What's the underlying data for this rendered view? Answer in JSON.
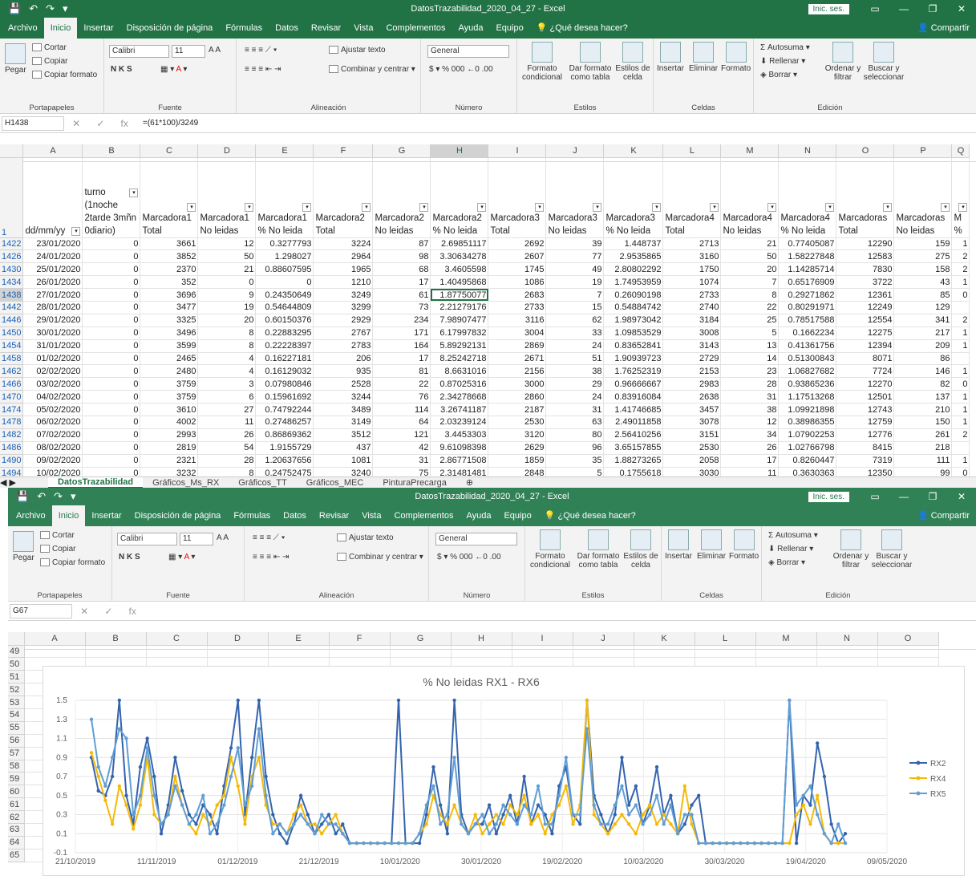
{
  "window1": {
    "title": "DatosTrazabilidad_2020_04_27  -  Excel",
    "signin": "Inic. ses.",
    "tabs": [
      "Archivo",
      "Inicio",
      "Insertar",
      "Disposición de página",
      "Fórmulas",
      "Datos",
      "Revisar",
      "Vista",
      "Complementos",
      "Ayuda",
      "Equipo",
      "¿Qué desea hacer?"
    ],
    "share": "Compartir",
    "ribbon": {
      "pegar": "Pegar",
      "cortar": "Cortar",
      "copiar": "Copiar",
      "copiar_formato": "Copiar formato",
      "portapapeles": "Portapapeles",
      "font": "Calibri",
      "size": "11",
      "fuente": "Fuente",
      "ajustar": "Ajustar texto",
      "combinar": "Combinar y centrar",
      "alineacion": "Alineación",
      "general": "General",
      "numero": "Número",
      "formato_cond": "Formato condicional",
      "formato_tabla": "Dar formato como tabla",
      "estilos_celda": "Estilos de celda",
      "estilos": "Estilos",
      "insertar": "Insertar",
      "eliminar": "Eliminar",
      "formato": "Formato",
      "celdas": "Celdas",
      "autosuma": "Autosuma",
      "rellenar": "Rellenar",
      "borrar": "Borrar",
      "ordenar": "Ordenar y filtrar",
      "buscar": "Buscar y seleccionar",
      "edicion": "Edición"
    },
    "namebox": "H1438",
    "formula": "=(61*100)/3249",
    "columns": [
      "A",
      "B",
      "C",
      "D",
      "E",
      "F",
      "G",
      "H",
      "I",
      "J",
      "K",
      "L",
      "M",
      "N",
      "O",
      "P",
      "Q"
    ],
    "header_row": "1",
    "headers": [
      "dd/mm/yy",
      "turno (1noche 2tarde 3mñn 0diario)",
      "Marcadora1 Total",
      "Marcadora1 No leidas",
      "Marcadora1 % No leida",
      "Marcadora2 Total",
      "Marcadora2 No leidas",
      "Marcadora2 % No leida",
      "Marcadora3 Total",
      "Marcadora3 No leidas",
      "Marcadora3 % No leida",
      "Marcadora4 Total",
      "Marcadora4 No leidas",
      "Marcadora4 % No leida",
      "Marcadoras Total",
      "Marcadoras No leidas",
      "M %"
    ],
    "rows": [
      {
        "r": "1422",
        "c": [
          "23/01/2020",
          "0",
          "3661",
          "12",
          "0.3277793",
          "3224",
          "87",
          "2.69851117",
          "2692",
          "39",
          "1.448737",
          "2713",
          "21",
          "0.77405087",
          "12290",
          "159",
          "1"
        ]
      },
      {
        "r": "1426",
        "c": [
          "24/01/2020",
          "0",
          "3852",
          "50",
          "1.298027",
          "2964",
          "98",
          "3.30634278",
          "2607",
          "77",
          "2.9535865",
          "3160",
          "50",
          "1.58227848",
          "12583",
          "275",
          "2"
        ]
      },
      {
        "r": "1430",
        "c": [
          "25/01/2020",
          "0",
          "2370",
          "21",
          "0.88607595",
          "1965",
          "68",
          "3.4605598",
          "1745",
          "49",
          "2.80802292",
          "1750",
          "20",
          "1.14285714",
          "7830",
          "158",
          "2"
        ]
      },
      {
        "r": "1434",
        "c": [
          "26/01/2020",
          "0",
          "352",
          "0",
          "0",
          "1210",
          "17",
          "1.40495868",
          "1086",
          "19",
          "1.74953959",
          "1074",
          "7",
          "0.65176909",
          "3722",
          "43",
          "1"
        ]
      },
      {
        "r": "1438",
        "c": [
          "27/01/2020",
          "0",
          "3696",
          "9",
          "0.24350649",
          "3249",
          "61",
          "1.87750077",
          "2683",
          "7",
          "0.26090198",
          "2733",
          "8",
          "0.29271862",
          "12361",
          "85",
          "0"
        ]
      },
      {
        "r": "1442",
        "c": [
          "28/01/2020",
          "0",
          "3477",
          "19",
          "0.54644809",
          "3299",
          "73",
          "2.21279176",
          "2733",
          "15",
          "0.54884742",
          "2740",
          "22",
          "0.80291971",
          "12249",
          "129",
          ""
        ]
      },
      {
        "r": "1446",
        "c": [
          "29/01/2020",
          "0",
          "3325",
          "20",
          "0.60150376",
          "2929",
          "234",
          "7.98907477",
          "3116",
          "62",
          "1.98973042",
          "3184",
          "25",
          "0.78517588",
          "12554",
          "341",
          "2"
        ]
      },
      {
        "r": "1450",
        "c": [
          "30/01/2020",
          "0",
          "3496",
          "8",
          "0.22883295",
          "2767",
          "171",
          "6.17997832",
          "3004",
          "33",
          "1.09853529",
          "3008",
          "5",
          "0.1662234",
          "12275",
          "217",
          "1"
        ]
      },
      {
        "r": "1454",
        "c": [
          "31/01/2020",
          "0",
          "3599",
          "8",
          "0.22228397",
          "2783",
          "164",
          "5.89292131",
          "2869",
          "24",
          "0.83652841",
          "3143",
          "13",
          "0.41361756",
          "12394",
          "209",
          "1"
        ]
      },
      {
        "r": "1458",
        "c": [
          "01/02/2020",
          "0",
          "2465",
          "4",
          "0.16227181",
          "206",
          "17",
          "8.25242718",
          "2671",
          "51",
          "1.90939723",
          "2729",
          "14",
          "0.51300843",
          "8071",
          "86",
          ""
        ]
      },
      {
        "r": "1462",
        "c": [
          "02/02/2020",
          "0",
          "2480",
          "4",
          "0.16129032",
          "935",
          "81",
          "8.6631016",
          "2156",
          "38",
          "1.76252319",
          "2153",
          "23",
          "1.06827682",
          "7724",
          "146",
          "1"
        ]
      },
      {
        "r": "1466",
        "c": [
          "03/02/2020",
          "0",
          "3759",
          "3",
          "0.07980846",
          "2528",
          "22",
          "0.87025316",
          "3000",
          "29",
          "0.96666667",
          "2983",
          "28",
          "0.93865236",
          "12270",
          "82",
          "0"
        ]
      },
      {
        "r": "1470",
        "c": [
          "04/02/2020",
          "0",
          "3759",
          "6",
          "0.15961692",
          "3244",
          "76",
          "2.34278668",
          "2860",
          "24",
          "0.83916084",
          "2638",
          "31",
          "1.17513268",
          "12501",
          "137",
          "1"
        ]
      },
      {
        "r": "1474",
        "c": [
          "05/02/2020",
          "0",
          "3610",
          "27",
          "0.74792244",
          "3489",
          "114",
          "3.26741187",
          "2187",
          "31",
          "1.41746685",
          "3457",
          "38",
          "1.09921898",
          "12743",
          "210",
          "1"
        ]
      },
      {
        "r": "1478",
        "c": [
          "06/02/2020",
          "0",
          "4002",
          "11",
          "0.27486257",
          "3149",
          "64",
          "2.03239124",
          "2530",
          "63",
          "2.49011858",
          "3078",
          "12",
          "0.38986355",
          "12759",
          "150",
          "1"
        ]
      },
      {
        "r": "1482",
        "c": [
          "07/02/2020",
          "0",
          "2993",
          "26",
          "0.86869362",
          "3512",
          "121",
          "3.4453303",
          "3120",
          "80",
          "2.56410256",
          "3151",
          "34",
          "1.07902253",
          "12776",
          "261",
          "2"
        ]
      },
      {
        "r": "1486",
        "c": [
          "08/02/2020",
          "0",
          "2819",
          "54",
          "1.9155729",
          "437",
          "42",
          "9.61098398",
          "2629",
          "96",
          "3.65157855",
          "2530",
          "26",
          "1.02766798",
          "8415",
          "218",
          ""
        ]
      },
      {
        "r": "1490",
        "c": [
          "09/02/2020",
          "0",
          "2321",
          "28",
          "1.20637656",
          "1081",
          "31",
          "2.86771508",
          "1859",
          "35",
          "1.88273265",
          "2058",
          "17",
          "0.8260447",
          "7319",
          "111",
          "1"
        ]
      },
      {
        "r": "1494",
        "c": [
          "10/02/2020",
          "0",
          "3232",
          "8",
          "0.24752475",
          "3240",
          "75",
          "2.31481481",
          "2848",
          "5",
          "0.1755618",
          "3030",
          "11",
          "0.3630363",
          "12350",
          "99",
          "0"
        ]
      }
    ],
    "sheet_tabs": [
      "DatosTrazabilidad",
      "Gráficos_Ms_RX",
      "Gráficos_TT",
      "Gráficos_MEC",
      "PinturaPrecarga"
    ]
  },
  "window2": {
    "title": "DatosTrazabilidad_2020_04_27  -  Excel",
    "signin": "Inic. ses.",
    "tabs": [
      "Archivo",
      "Inicio",
      "Insertar",
      "Disposición de página",
      "Fórmulas",
      "Datos",
      "Revisar",
      "Vista",
      "Complementos",
      "Ayuda",
      "Equipo",
      "¿Qué desea hacer?"
    ],
    "share": "Compartir",
    "namebox": "G67",
    "columns": [
      "A",
      "B",
      "C",
      "D",
      "E",
      "F",
      "G",
      "H",
      "I",
      "J",
      "K",
      "L",
      "M",
      "N",
      "O"
    ],
    "rows": [
      "49",
      "50",
      "51",
      "52",
      "53",
      "54",
      "55",
      "56",
      "57",
      "58",
      "59",
      "60",
      "61",
      "62",
      "63",
      "64",
      "65"
    ]
  },
  "chart_data": {
    "type": "line",
    "title": "% No leidas RX1 - RX6",
    "xlabel": "",
    "ylabel": "",
    "ylim": [
      0,
      1.5
    ],
    "yticks": [
      "1.5",
      "1.3",
      "1.1",
      "0.9",
      "0.7",
      "0.5",
      "0.3",
      "0.1",
      "-0.1"
    ],
    "xticks": [
      "21/10/2019",
      "11/11/2019",
      "01/12/2019",
      "21/12/2019",
      "10/01/2020",
      "30/01/2020",
      "19/02/2020",
      "10/03/2020",
      "30/03/2020",
      "19/04/2020",
      "09/05/2020"
    ],
    "legend_position": "right",
    "series": [
      {
        "name": "RX2",
        "color": "#2e5fab",
        "values": [
          0.9,
          0.55,
          0.5,
          0.7,
          1.5,
          0.5,
          0.2,
          0.8,
          1.1,
          0.7,
          0.1,
          0.4,
          0.9,
          0.55,
          0.3,
          0.2,
          0.4,
          0.3,
          0.1,
          0.6,
          1.0,
          1.5,
          0.3,
          0.9,
          1.5,
          0.7,
          0.3,
          0.1,
          0.0,
          0.2,
          0.5,
          0.3,
          0.1,
          0.2,
          0.3,
          0.1,
          0.2,
          0.0,
          0.0,
          0.0,
          0.0,
          0.0,
          0.0,
          0.0,
          1.5,
          0.0,
          0.0,
          0.0,
          0.3,
          0.8,
          0.4,
          0.1,
          1.5,
          0.3,
          0.1,
          0.2,
          0.2,
          0.4,
          0.1,
          0.3,
          0.5,
          0.2,
          0.7,
          0.2,
          0.4,
          0.3,
          0.1,
          0.6,
          0.8,
          0.3,
          0.2,
          1.5,
          0.5,
          0.3,
          0.1,
          0.3,
          0.9,
          0.4,
          0.6,
          0.2,
          0.4,
          0.8,
          0.3,
          0.5,
          0.1,
          0.2,
          0.4,
          0.5,
          0.0,
          0.0,
          0.0,
          0.0,
          0.0,
          0.0,
          0.0,
          0.0,
          0.0,
          0.0,
          0.0,
          0.0,
          1.5,
          0.0,
          0.5,
          0.4,
          1.05,
          0.7,
          0.2,
          0.0,
          0.1
        ]
      },
      {
        "name": "RX4",
        "color": "#f5b800",
        "values": [
          0.95,
          0.7,
          0.45,
          0.2,
          0.6,
          0.4,
          0.15,
          0.4,
          0.9,
          0.3,
          0.2,
          0.3,
          0.7,
          0.4,
          0.2,
          0.1,
          0.3,
          0.2,
          0.4,
          0.5,
          0.9,
          0.6,
          0.2,
          0.7,
          0.9,
          0.4,
          0.2,
          0.2,
          0.1,
          0.3,
          0.4,
          0.2,
          0.2,
          0.1,
          0.2,
          0.3,
          0.1,
          0.0,
          0.0,
          0.0,
          0.0,
          0.0,
          0.0,
          0.0,
          0.0,
          0.0,
          0.0,
          0.1,
          0.2,
          0.5,
          0.3,
          0.2,
          0.4,
          0.2,
          0.1,
          0.3,
          0.1,
          0.2,
          0.3,
          0.2,
          0.4,
          0.3,
          0.5,
          0.2,
          0.3,
          0.1,
          0.3,
          0.4,
          0.6,
          0.2,
          0.4,
          1.5,
          0.3,
          0.2,
          0.1,
          0.2,
          0.3,
          0.2,
          0.1,
          0.3,
          0.4,
          0.2,
          0.3,
          0.2,
          0.1,
          0.6,
          0.2,
          0.0,
          0.0,
          0.0,
          0.0,
          0.0,
          0.0,
          0.0,
          0.0,
          0.0,
          0.0,
          0.0,
          0.0,
          0.0,
          0.0,
          0.3,
          0.4,
          0.2,
          0.5,
          0.1,
          0.0,
          0.0,
          0.0
        ]
      },
      {
        "name": "RX5",
        "color": "#5b9bd5",
        "values": [
          1.3,
          0.8,
          0.6,
          0.9,
          1.2,
          1.1,
          0.3,
          0.5,
          1.0,
          0.5,
          0.2,
          0.3,
          0.6,
          0.4,
          0.2,
          0.3,
          0.5,
          0.1,
          0.2,
          0.4,
          0.7,
          1.0,
          0.4,
          0.6,
          1.2,
          0.5,
          0.1,
          0.2,
          0.1,
          0.2,
          0.3,
          0.2,
          0.1,
          0.3,
          0.2,
          0.2,
          0.1,
          0.0,
          0.0,
          0.0,
          0.0,
          0.0,
          0.0,
          0.0,
          0.0,
          0.0,
          0.0,
          0.1,
          0.4,
          0.6,
          0.2,
          0.3,
          0.9,
          0.2,
          0.1,
          0.2,
          0.3,
          0.1,
          0.2,
          0.4,
          0.3,
          0.2,
          0.4,
          0.3,
          0.6,
          0.2,
          0.2,
          0.5,
          0.9,
          0.3,
          0.3,
          1.2,
          0.4,
          0.2,
          0.2,
          0.4,
          0.6,
          0.3,
          0.4,
          0.2,
          0.3,
          0.5,
          0.2,
          0.4,
          0.1,
          0.3,
          0.3,
          0.0,
          0.0,
          0.0,
          0.0,
          0.0,
          0.0,
          0.0,
          0.0,
          0.0,
          0.0,
          0.0,
          0.0,
          0.0,
          1.5,
          0.4,
          0.5,
          0.6,
          0.3,
          0.1,
          0.0,
          0.2,
          0.0
        ]
      }
    ]
  }
}
